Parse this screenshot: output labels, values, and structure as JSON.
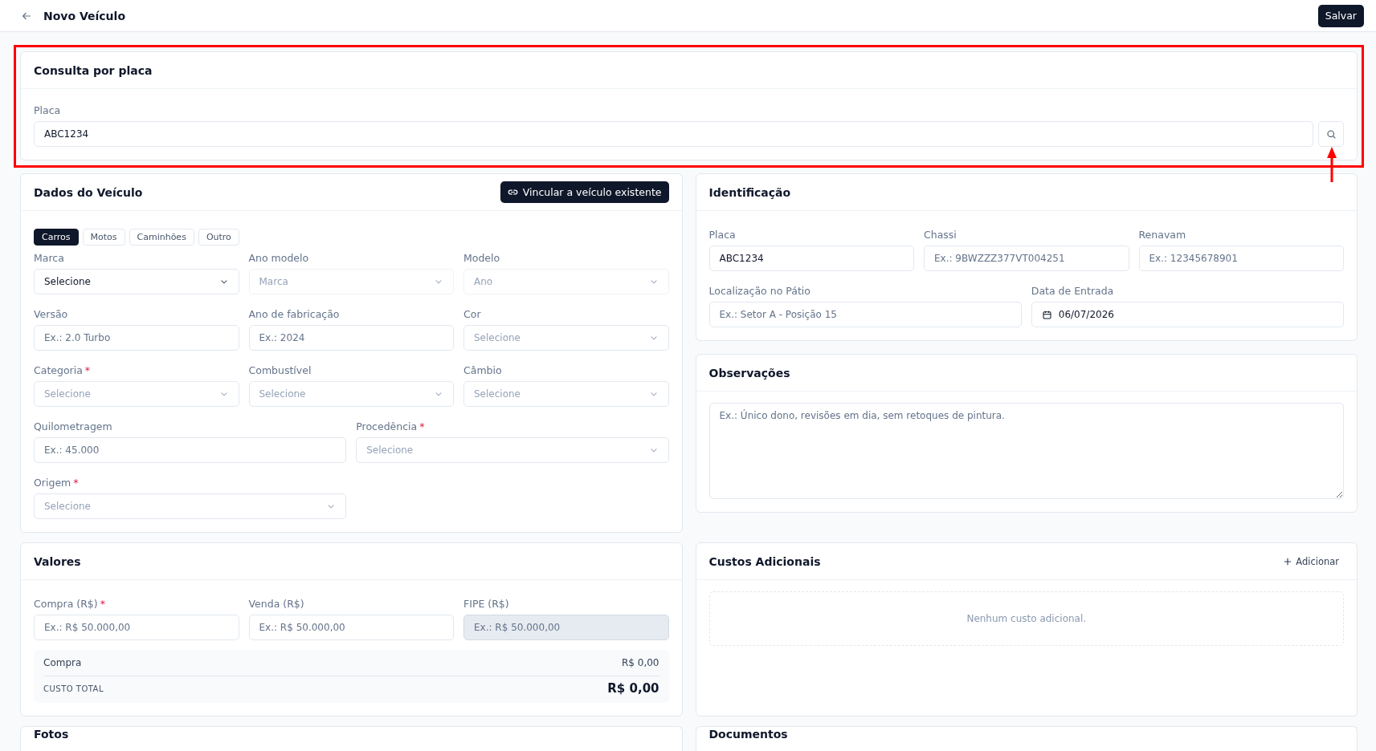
{
  "header": {
    "title": "Novo Veículo",
    "save_button": "Salvar"
  },
  "plate_lookup": {
    "title": "Consulta por placa",
    "label": "Placa",
    "value": "ABC1234"
  },
  "vehicle_data": {
    "title": "Dados do Veículo",
    "link_button": "Vincular a veículo existente",
    "tabs": [
      {
        "label": "Carros",
        "selected": true
      },
      {
        "label": "Motos",
        "selected": false
      },
      {
        "label": "Caminhões",
        "selected": false
      },
      {
        "label": "Outro",
        "selected": false
      }
    ],
    "rows": [
      {
        "fields": [
          {
            "kind": "select",
            "label": "Marca",
            "value": "Selecione",
            "disabled": false
          },
          {
            "kind": "select",
            "label": "Ano modelo",
            "placeholder": "Marca",
            "disabled": true
          },
          {
            "kind": "select",
            "label": "Modelo",
            "placeholder": "Ano",
            "disabled": true
          }
        ]
      },
      {
        "fields": [
          {
            "kind": "input",
            "label": "Versão",
            "placeholder": "Ex.: 2.0 Turbo"
          },
          {
            "kind": "input",
            "label": "Ano de fabricação",
            "placeholder": "Ex.: 2024"
          },
          {
            "kind": "select",
            "label": "Cor",
            "placeholder": "Selecione",
            "disabled": false
          }
        ]
      },
      {
        "fields": [
          {
            "kind": "select",
            "label": "Categoria",
            "required_mark": "*",
            "placeholder": "Selecione",
            "disabled": false
          },
          {
            "kind": "select",
            "label": "Combustível",
            "placeholder": "Selecione",
            "disabled": false
          },
          {
            "kind": "select",
            "label": "Câmbio",
            "placeholder": "Selecione",
            "disabled": false
          }
        ]
      },
      {
        "fields": [
          {
            "kind": "input",
            "label": "Quilometragem",
            "placeholder": "Ex.: 45.000"
          },
          {
            "kind": "select",
            "label": "Procedência",
            "required_mark": "*",
            "placeholder": "Selecione",
            "disabled": false
          }
        ]
      },
      {
        "fields": [
          {
            "kind": "select",
            "label": "Origem",
            "required_mark": "*",
            "placeholder": "Selecione",
            "disabled": false
          }
        ]
      }
    ]
  },
  "values": {
    "title": "Valores",
    "fields": [
      {
        "label": "Compra (R$)",
        "required_mark": "*",
        "placeholder": "Ex.: R$ 50.000,00",
        "disabled": false
      },
      {
        "label": "Venda (R$)",
        "placeholder": "Ex.: R$ 50.000,00",
        "disabled": false
      },
      {
        "label": "FIPE (R$)",
        "placeholder": "Ex.: R$ 50.000,00",
        "disabled": true
      }
    ],
    "summary": [
      {
        "label": "Compra",
        "amount": "R$ 0,00"
      }
    ],
    "total": {
      "label": "CUSTO TOTAL",
      "amount": "R$ 0,00"
    }
  },
  "photos": {
    "title": "Fotos"
  },
  "identification": {
    "title": "Identificação",
    "rows": [
      {
        "fields": [
          {
            "kind": "input",
            "label": "Placa",
            "value": "ABC1234"
          },
          {
            "kind": "input",
            "label": "Chassi",
            "placeholder": "Ex.: 9BWZZZ377VT004251"
          },
          {
            "kind": "input",
            "label": "Renavam",
            "placeholder": "Ex.: 12345678901"
          }
        ]
      },
      {
        "fields": [
          {
            "kind": "input",
            "label": "Localização no Pátio",
            "placeholder": "Ex.: Setor A - Posição 15"
          },
          {
            "kind": "date",
            "label": "Data de Entrada",
            "value": "06/07/2026"
          }
        ]
      }
    ]
  },
  "notes": {
    "title": "Observações",
    "placeholder": "Ex.: Único dono, revisões em dia, sem retoques de pintura."
  },
  "additional_costs": {
    "title": "Custos Adicionais",
    "add_button": "Adicionar",
    "empty_message": "Nenhum custo adicional."
  },
  "documents": {
    "title": "Documentos"
  }
}
